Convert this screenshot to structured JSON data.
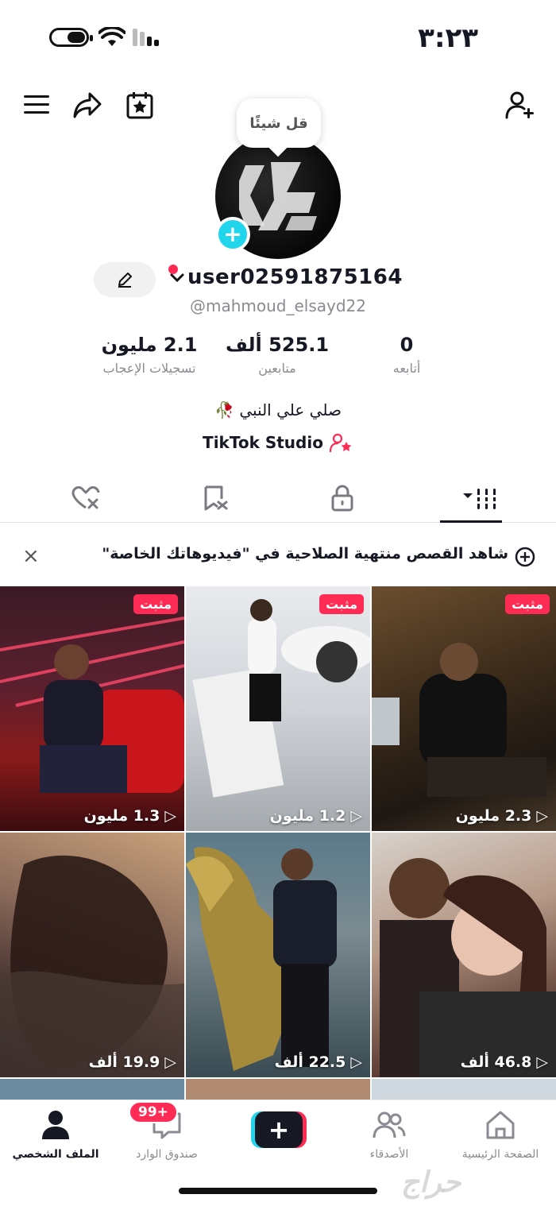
{
  "status_bar": {
    "time": "٣:٢٣"
  },
  "profile": {
    "bubble_text": "قل شيئًا",
    "username": "user02591875164",
    "handle": "@mahmoud_elsayd22",
    "stats": [
      {
        "value": "0",
        "label": "أتابعه"
      },
      {
        "value": "525.1 ألف",
        "label": "متابعين"
      },
      {
        "value": "2.1 مليون",
        "label": "تسجيلات الإعجاب"
      }
    ],
    "bio": "صلي علي النبي 🥀",
    "studio_label": "TikTok Studio"
  },
  "tabs": [
    "videos",
    "private",
    "reposts",
    "liked"
  ],
  "banner": {
    "text": "شاهد القصص منتهية الصلاحية في \"فيديوهاتك الخاصة\""
  },
  "videos": [
    {
      "views": "2.3 مليون",
      "pinned": "مثبت"
    },
    {
      "views": "1.2 مليون",
      "pinned": "مثبت"
    },
    {
      "views": "1.3 مليون",
      "pinned": "مثبت"
    },
    {
      "views": "46.8 ألف"
    },
    {
      "views": "22.5 ألف"
    },
    {
      "views": "19.9 ألف"
    }
  ],
  "nav": {
    "home": "الصفحة الرئيسية",
    "friends": "الأصدقاء",
    "create": "+",
    "inbox": "صندوق الوارد",
    "inbox_badge": "99+",
    "profile": "الملف الشخصي"
  },
  "watermark": "حراج"
}
